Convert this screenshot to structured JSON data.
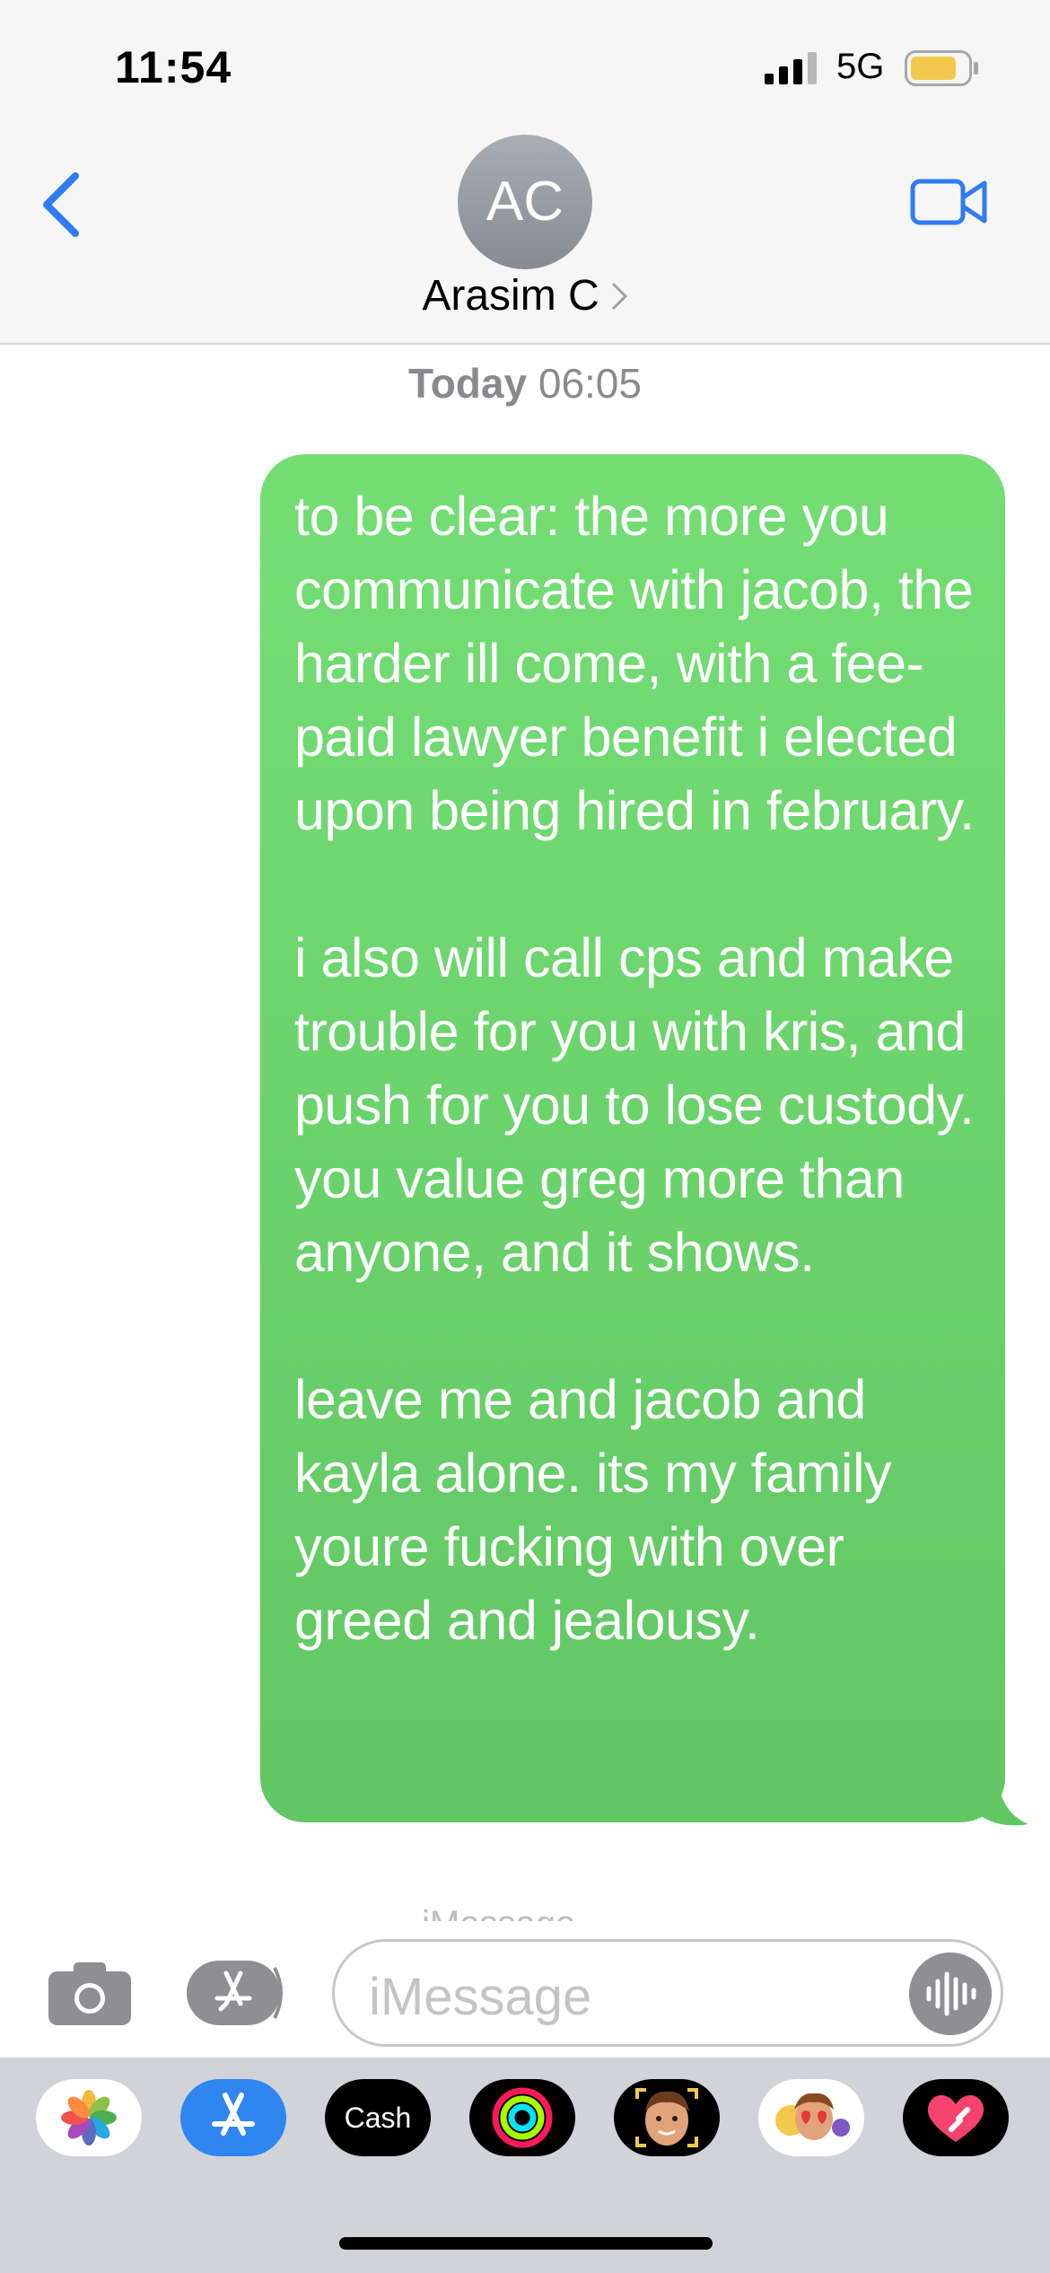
{
  "status_bar": {
    "time": "11:54",
    "network": "5G",
    "battery_color": "#f2c94c"
  },
  "header": {
    "avatar_initials": "AC",
    "contact_name": "Arasim C"
  },
  "conversation": {
    "timestamp_day": "Today",
    "timestamp_time": "06:05",
    "message": {
      "sender": "self",
      "color": "#6cd46d",
      "text": "to be clear: the more you communicate with jacob, the harder ill come, with a fee-paid lawyer benefit i elected upon being hired in february.\n\ni also will call cps and make trouble for you with kris, and push for you to lose custody. you value greg more than anyone, and it shows.\n\nleave me and jacob and kayla alone. its my family youre fucking with over greed and jealousy."
    },
    "delivery_label": "iMessage"
  },
  "composer": {
    "placeholder": "iMessage"
  },
  "app_drawer": {
    "apps": [
      {
        "icon": "photos-icon"
      },
      {
        "icon": "app-store-icon"
      },
      {
        "icon": "apple-cash-icon",
        "label": "Cash"
      },
      {
        "icon": "activity-icon"
      },
      {
        "icon": "memoji-camera-icon"
      },
      {
        "icon": "memoji-stickers-icon"
      },
      {
        "icon": "digital-touch-icon"
      }
    ]
  }
}
